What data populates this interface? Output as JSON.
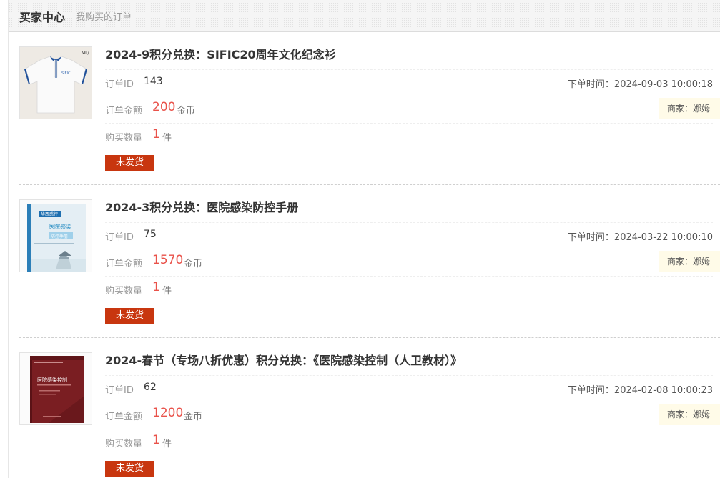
{
  "header": {
    "title": "买家中心",
    "breadcrumb": "我购买的订单"
  },
  "labels": {
    "order_id": "订单ID",
    "amount": "订单金额",
    "quantity": "购买数量",
    "coin_unit": "金币",
    "piece_unit": "件"
  },
  "orders": [
    {
      "name": "2024-9积分兑换：SIFIC20周年文化纪念衫",
      "id": "143",
      "time": "下单时间：2024-09-03 10:00:18",
      "amount": "200",
      "seller": "商家：娜姆",
      "quantity": "1",
      "status": "未发货",
      "thumb_icon": "polo-shirt-image"
    },
    {
      "name": "2024-3积分兑换：医院感染防控手册",
      "id": "75",
      "time": "下单时间：2024-03-22 10:00:10",
      "amount": "1570",
      "seller": "商家：娜姆",
      "quantity": "1",
      "status": "未发货",
      "thumb_icon": "book-cover-image"
    },
    {
      "name": "2024-春节（专场八折优惠）积分兑换：《医院感染控制（人卫教材）》",
      "id": "62",
      "time": "下单时间：2024-02-08 10:00:23",
      "amount": "1200",
      "seller": "商家：娜姆",
      "quantity": "1",
      "status": "未发货",
      "thumb_icon": "textbook-cover-image"
    }
  ],
  "colors": {
    "status_bg": "#c8360f",
    "price": "#e9524a",
    "seller_bg": "#fffbe8"
  }
}
